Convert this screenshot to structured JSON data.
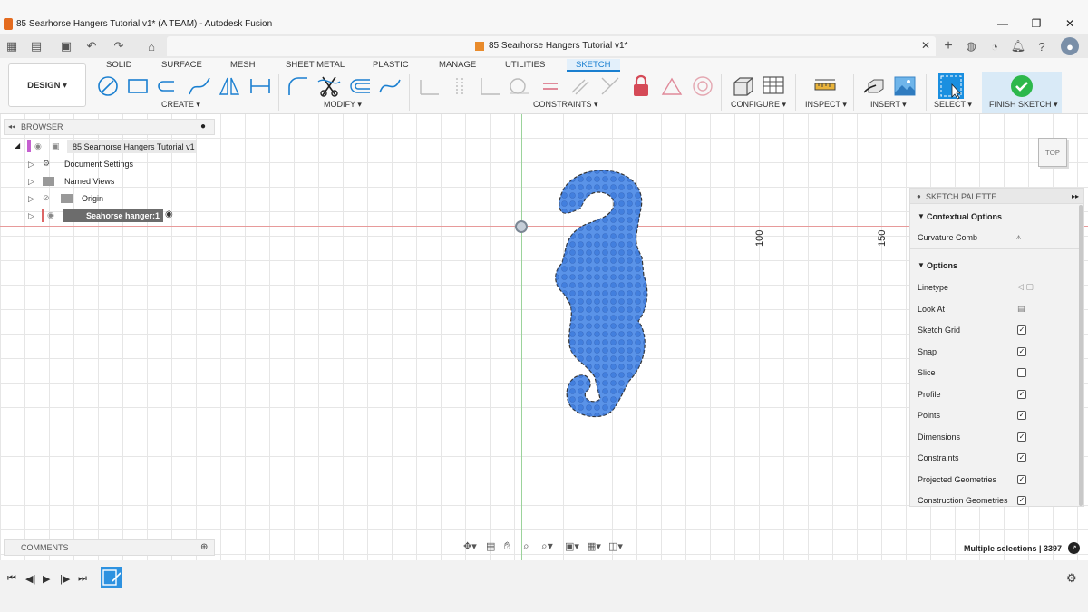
{
  "window": {
    "title": "85 Searhorse Hangers Tutorial v1* (A TEAM) - Autodesk Fusion",
    "minimize": "—",
    "maximize": "❐",
    "close": "✕"
  },
  "document_tab": {
    "title": "85 Searhorse Hangers Tutorial v1*",
    "close": "✕"
  },
  "workspace": {
    "label": "DESIGN ▾"
  },
  "ribbon_tabs": [
    "SOLID",
    "SURFACE",
    "MESH",
    "SHEET METAL",
    "PLASTIC",
    "MANAGE",
    "UTILITIES",
    "SKETCH"
  ],
  "active_tab": "SKETCH",
  "groups": {
    "create": "CREATE ▾",
    "modify": "MODIFY ▾",
    "constraints": "CONSTRAINTS ▾",
    "configure": "CONFIGURE ▾",
    "inspect": "INSPECT ▾",
    "insert": "INSERT ▾",
    "select": "SELECT ▾",
    "finish": "FINISH SKETCH ▾"
  },
  "browser": {
    "header": "BROWSER",
    "root": "85 Searhorse Hangers Tutorial v1",
    "items": [
      "Document Settings",
      "Named Views",
      "Origin",
      "Seahorse hanger:1"
    ]
  },
  "axis_labels": [
    "100",
    "150"
  ],
  "viewcube": {
    "face": "TOP"
  },
  "sketch_palette": {
    "header": "SKETCH PALETTE",
    "contextual_header": "Contextual Options",
    "curvature_comb": "Curvature Comb",
    "options_header": "Options",
    "options": [
      {
        "label": "Linetype",
        "type": "icons"
      },
      {
        "label": "Look At",
        "type": "icon"
      },
      {
        "label": "Sketch Grid",
        "checked": true
      },
      {
        "label": "Snap",
        "checked": true
      },
      {
        "label": "Slice",
        "checked": false
      },
      {
        "label": "Profile",
        "checked": true
      },
      {
        "label": "Points",
        "checked": true
      },
      {
        "label": "Dimensions",
        "checked": true
      },
      {
        "label": "Constraints",
        "checked": true
      },
      {
        "label": "Projected Geometries",
        "checked": true
      },
      {
        "label": "Construction Geometries",
        "checked": true
      }
    ]
  },
  "comments": {
    "label": "COMMENTS"
  },
  "status": {
    "text": "Multiple selections | 3397"
  },
  "colors": {
    "accent": "#1a7fd0",
    "selection_fill": "#3d7fe0",
    "finish_green": "#2db84b",
    "axis_red": "#e79a9a",
    "axis_green": "#9bd39b"
  }
}
